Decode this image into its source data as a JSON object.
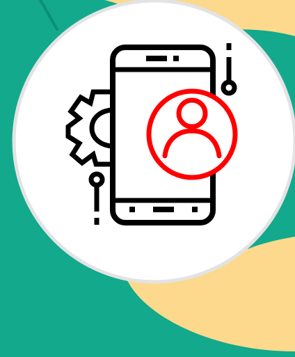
{
  "illustration": {
    "subject": "mobile-user-profile-icon",
    "icons": [
      "smartphone-icon",
      "gear-icon",
      "user-avatar-icon",
      "circuit-line-icon"
    ]
  },
  "colors": {
    "background_teal": "#12A98D",
    "background_sand": "#FCD98C",
    "badge_fill": "#FFFFFF",
    "badge_border": "#E3E3E3",
    "icon_stroke": "#000000",
    "accent_red": "#FF0000"
  }
}
